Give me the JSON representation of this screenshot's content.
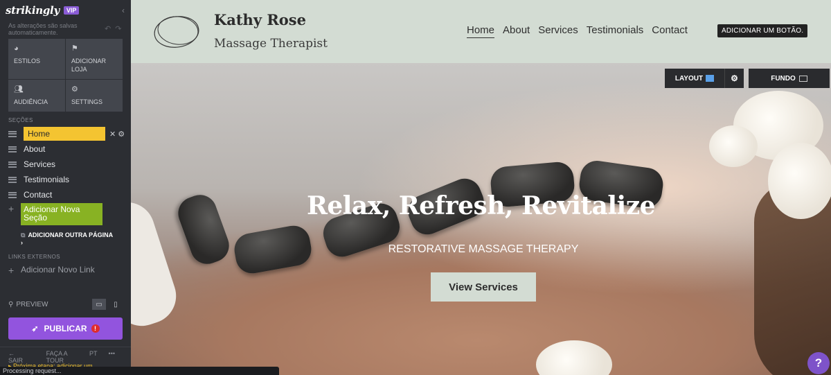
{
  "sidebar": {
    "logo": "strikingly",
    "vip": "VIP",
    "collapse_icon": "chevron-left-icon",
    "autosave": "As alterações são salvas automaticamente.",
    "tools": [
      {
        "label": "ESTILOS",
        "icon": "palette-icon"
      },
      {
        "label": "ADICIONAR LOJA",
        "icon": "store-icon"
      },
      {
        "label": "AUDIÊNCIA",
        "icon": "people-icon"
      },
      {
        "label": "SETTINGS",
        "icon": "gear-icon"
      }
    ],
    "sections_label": "SEÇÕES",
    "sections": [
      "Home",
      "About",
      "Services",
      "Testimonials",
      "Contact"
    ],
    "add_section": "Adicionar Nova Seção",
    "add_page": "ADICIONAR OUTRA PÁGINA",
    "external_links_label": "LINKS EXTERNOS",
    "add_link": "Adicionar Novo Link",
    "preview": "PREVIEW",
    "publish": "PUBLICAR",
    "bottom": {
      "exit": "SAIR",
      "tour": "FAÇA A TOUR",
      "lang": "PT",
      "more": "•••"
    },
    "next_steps": "Próxima etapa: adicionar um",
    "processing": "Processing request..."
  },
  "header": {
    "name": "Kathy Rose",
    "subtitle": "Massage Therapist",
    "nav": [
      "Home",
      "About",
      "Services",
      "Testimonials",
      "Contact"
    ],
    "add_button": "ADICIONAR UM BOTÃO."
  },
  "hero": {
    "title": "Relax, Refresh, Revitalize",
    "subtitle": "RESTORATIVE MASSAGE THERAPY",
    "cta": "View Services",
    "layout_label": "LAYOUT",
    "background_label": "FUNDO"
  },
  "colors": {
    "accent_yellow": "#f4c431",
    "accent_green": "#88b223",
    "publish_purple": "#9254de",
    "header_bg": "#d3dcd3"
  }
}
